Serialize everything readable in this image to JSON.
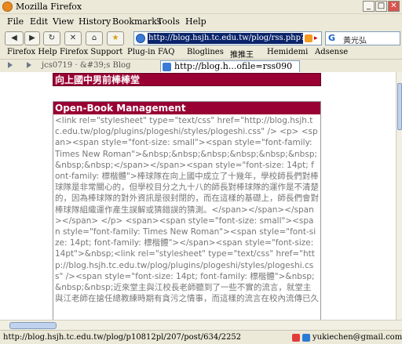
{
  "window": {
    "title": "Mozilla Firefox"
  },
  "menus": [
    "File",
    "Edit",
    "View",
    "History",
    "Bookmarks",
    "Tools",
    "Help"
  ],
  "nav": {
    "url": "http://blog.hsjh.tc.edu.tw/plog/rss.php?blogId",
    "search_text": "黃光弘"
  },
  "bookmarks": [
    "Firefox Help",
    "Firefox Support",
    "Plug-in FAQ",
    "Bloglines",
    "推推王",
    "Hemidemi",
    "Adsense"
  ],
  "tabs": {
    "first": "jcs0719 · &#39;s Blog",
    "tooltip": "http://blog.h...ofile=rss090"
  },
  "blog": {
    "title": "向上國中男前棒棒堂",
    "post_title": "Open-Book Management",
    "post_body": "<link rel=\"stylesheet\" type=\"text/css\" href=\"http://blog.hsjh.tc.edu.tw/plog/plugins/plogeshi/styles/plogeshi.css\" /> <p> <span><span style=\"font-size: small\"><span style=\"font-family: Times New Roman\">&nbsp;&nbsp;&nbsp;&nbsp;&nbsp;&nbsp;&nbsp;&nbsp;</span></span><span style=\"font-size: 14pt; font-family: 標楷體\">棒球隊在向上國中成立了十幾年，學校師長們對棒球隊是非常關心的，但學校目分之九十八的師長對棒球隊的運作是不清楚的，因為棒球隊的對外資訊是很封閉的，而在這樣的基礎上，師長們會對棒球隊組織運作產生誤解或猜錯誤的猜測。</span></span></span></span> </p> <span><span style=\"font-size: small\"><span style=\"font-family: Times New Roman\"><span style=\"font-size: 14pt; font-family: 標楷體\"></span><span style=\"font-size: 14pt\">&nbsp;<link rel=\"stylesheet\" type=\"text/css\" href=\"http://blog.hsjh.tc.edu.tw/plog/plugins/plogeshi/styles/plogeshi.css\" /><span style=\"font-size: 14pt; font-family: 標楷體\">&nbsp;&nbsp;&nbsp;近來堂主與江校長老師聽到了一些不實的流言，就堂主與江老師在搶任總教練時期有貪污之情事，而這樣的流言在校內流傳已久"
  },
  "status": {
    "text": "http://blog.hsjh.tc.edu.tw/plog/p10812pl/207/post/634/2252",
    "email": "yukiechen@gmail.com"
  }
}
